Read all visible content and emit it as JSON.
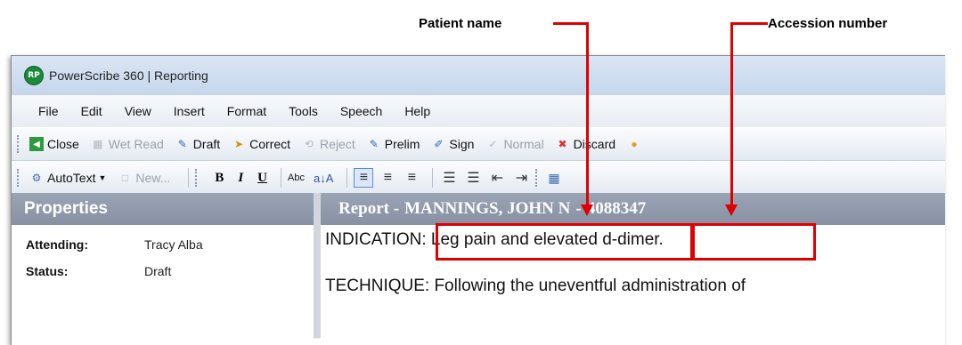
{
  "annotations": {
    "patient_name_label": "Patient name",
    "accession_label": "Accession number"
  },
  "window": {
    "title": "PowerScribe 360 | Reporting",
    "app_icon_text": "RP"
  },
  "menu": [
    "File",
    "Edit",
    "View",
    "Insert",
    "Format",
    "Tools",
    "Speech",
    "Help"
  ],
  "toolbar1": [
    {
      "label": "Close",
      "icon": "close-icon",
      "enabled": true
    },
    {
      "label": "Wet Read",
      "icon": "wet-read-icon",
      "enabled": false
    },
    {
      "label": "Draft",
      "icon": "draft-icon",
      "enabled": true
    },
    {
      "label": "Correct",
      "icon": "correct-icon",
      "enabled": true
    },
    {
      "label": "Reject",
      "icon": "reject-icon",
      "enabled": false
    },
    {
      "label": "Prelim",
      "icon": "prelim-icon",
      "enabled": true
    },
    {
      "label": "Sign",
      "icon": "sign-icon",
      "enabled": true
    },
    {
      "label": "Normal",
      "icon": "normal-icon",
      "enabled": false
    },
    {
      "label": "Discard",
      "icon": "discard-icon",
      "enabled": true
    }
  ],
  "toolbar2": {
    "autotext_label": "AutoText",
    "new_label": "New...",
    "bold": "B",
    "italic": "I",
    "underline": "U",
    "abc": "Abc"
  },
  "properties": {
    "header": "Properties",
    "rows": [
      {
        "label": "Attending:",
        "value": "Tracy Alba"
      },
      {
        "label": "Status:",
        "value": "Draft"
      }
    ]
  },
  "report": {
    "header_prefix": "Report -",
    "patient_name": "MANNINGS, JOHN N",
    "separator": "-",
    "accession": "4088347",
    "indication": "INDICATION: Leg pain and elevated d-dimer.",
    "technique": "TECHNIQUE: Following the uneventful administration of"
  },
  "colors": {
    "annotation_red": "#e10000",
    "pane_header": "#8e98a9"
  }
}
